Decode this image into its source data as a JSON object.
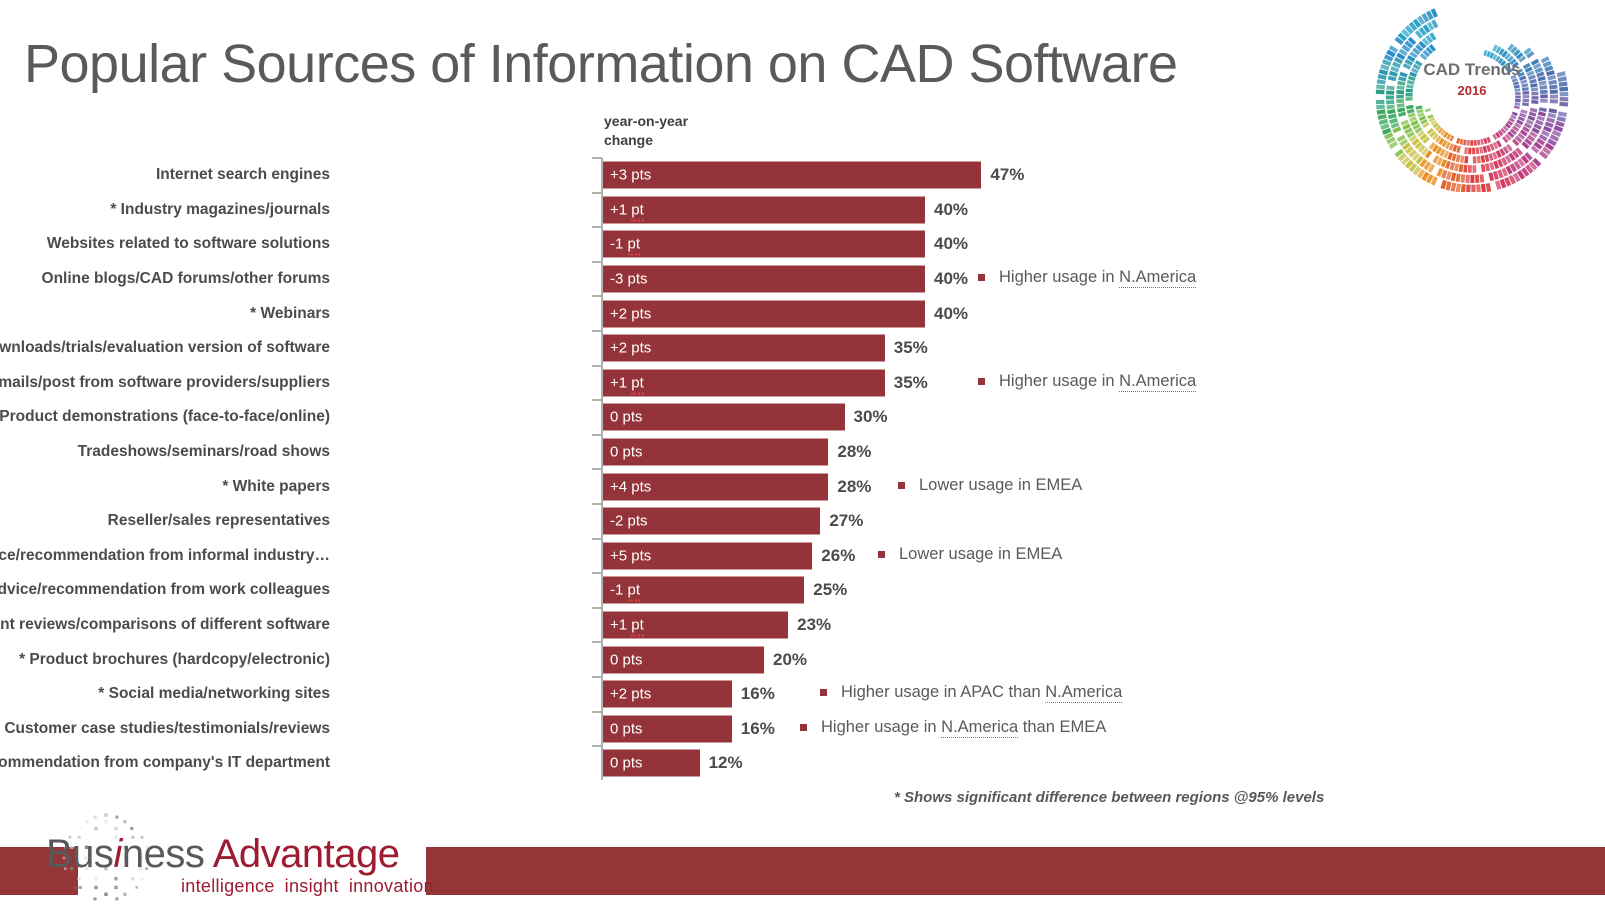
{
  "slide": {
    "title": "Popular Sources of Information on CAD Software",
    "footnote": "* Shows significant difference between regions @95% levels"
  },
  "cad_logo": {
    "main": "CAD Trends",
    "year": "2016",
    "icon": "cad-trends-circular-logo"
  },
  "brand_logo": {
    "word_1": "Bus",
    "word_i": "i",
    "word_2": "ness",
    "word_3": "Advantage",
    "tagline_1": "intelligence",
    "tagline_2": "insight",
    "tagline_3": "innovation",
    "icon": "globe-mosaic-icon"
  },
  "column_header": "year-on-year change",
  "colors": {
    "bar": "#94343a",
    "title": "#5a5a5a",
    "banner": "#943537",
    "brand_red": "#9e1b32"
  },
  "chart_data": {
    "type": "bar",
    "title": "Popular Sources of Information on CAD Software",
    "xlabel": "",
    "ylabel": "",
    "xlim": [
      0,
      50
    ],
    "grid": false,
    "orientation": "horizontal",
    "legend": "none",
    "categories": [
      "Internet search engines",
      "* Industry magazines/journals",
      "Websites related to software solutions",
      "Online blogs/CAD forums/other forums",
      "* Webinars",
      "Free downloads/trials/evaluation version of software",
      "Emails/post from software providers/suppliers",
      "* Product demonstrations (face-to-face/online)",
      "Tradeshows/seminars/road shows",
      "* White papers",
      "Reseller/sales representatives",
      "Advice/recommendation from informal industry…",
      "Advice/recommendation from work colleagues",
      "Independent reviews/comparisons of different software",
      "* Product brochures (hardcopy/electronic)",
      "* Social media/networking sites",
      "Customer case studies/testimonials/reviews",
      "Advice/recommendation from company's IT department"
    ],
    "values": [
      47,
      40,
      40,
      40,
      40,
      35,
      35,
      30,
      28,
      28,
      27,
      26,
      25,
      23,
      20,
      16,
      16,
      12
    ],
    "value_labels": [
      "47%",
      "40%",
      "40%",
      "40%",
      "40%",
      "35%",
      "35%",
      "30%",
      "28%",
      "28%",
      "27%",
      "26%",
      "25%",
      "23%",
      "20%",
      "16%",
      "16%",
      "12%"
    ],
    "change_labels": [
      "+3 pts",
      "+1 pt",
      "-1 pt",
      "-3 pts",
      "+2 pts",
      "+2 pts",
      "+1 pt",
      "0 pts",
      "0 pts",
      "+4 pts",
      "-2 pts",
      "+5 pts",
      "-1 pt",
      "+1 pt",
      "0 pts",
      "+2 pts",
      "0 pts",
      "0 pts"
    ]
  },
  "annotations": [
    {
      "text": "Higher usage in N.America",
      "row": 3
    },
    {
      "text": "Higher usage in N.America",
      "row": 6
    },
    {
      "text": "Lower usage in EMEA",
      "row": 9
    },
    {
      "text": "Lower usage in EMEA",
      "row": 11
    },
    {
      "text": "Higher usage in APAC than N.America",
      "row": 15
    },
    {
      "text": "Higher usage in N.America than EMEA",
      "row": 16
    }
  ]
}
